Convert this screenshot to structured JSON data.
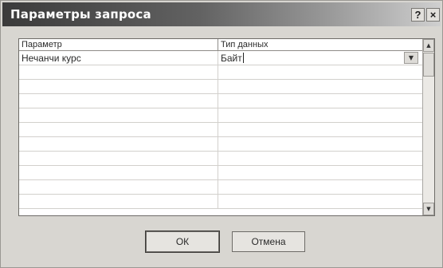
{
  "window": {
    "title": "Параметры запроса",
    "help_label": "?",
    "close_label": "×"
  },
  "grid": {
    "columns": [
      "Параметр",
      "Тип данных"
    ],
    "rows": [
      {
        "param": "Нечанчи курс",
        "type": "Байт"
      }
    ],
    "empty_rows": 10
  },
  "buttons": {
    "ok": "ОК",
    "cancel": "Отмена"
  }
}
